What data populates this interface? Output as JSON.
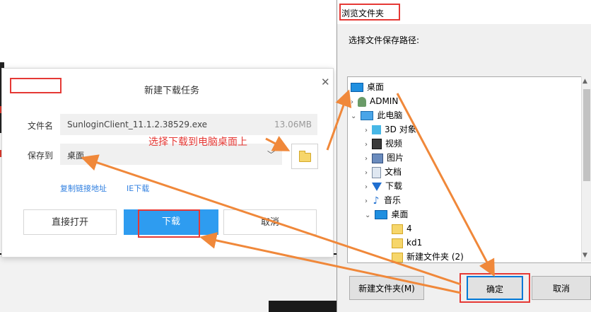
{
  "download_dialog": {
    "title": "新建下载任务",
    "close": "✕",
    "filename_label": "文件名",
    "filename": "SunloginClient_11.1.2.38529.exe",
    "filesize": "13.06MB",
    "saveto_label": "保存到",
    "saveto_value": "桌面",
    "copy_link": "复制链接地址",
    "ie_download": "IE下载",
    "btn_open": "直接打开",
    "btn_download": "下载",
    "btn_cancel": "取消"
  },
  "annotation": "选择下载到电脑桌面上",
  "browse_dialog": {
    "title": "浏览文件夹",
    "prompt": "选择文件保存路径:",
    "tree": [
      {
        "label": "桌面",
        "icon": "desktop-icon"
      },
      {
        "label": "ADMIN",
        "icon": "user-icon"
      },
      {
        "label": "此电脑",
        "icon": "computer-icon"
      },
      {
        "label": "3D 对象",
        "icon": "3d-objects-icon"
      },
      {
        "label": "视频",
        "icon": "video-icon"
      },
      {
        "label": "图片",
        "icon": "pictures-icon"
      },
      {
        "label": "文档",
        "icon": "documents-icon"
      },
      {
        "label": "下载",
        "icon": "download-icon"
      },
      {
        "label": "音乐",
        "icon": "music-icon"
      },
      {
        "label": "桌面",
        "icon": "desktop-icon"
      },
      {
        "label": "4",
        "icon": "folder-icon"
      },
      {
        "label": "kd1",
        "icon": "folder-icon"
      },
      {
        "label": "新建文件夹 (2)",
        "icon": "folder-icon"
      }
    ],
    "btn_new_folder": "新建文件夹(M)",
    "btn_ok": "确定",
    "btn_cancel": "取消"
  },
  "colors": {
    "accent": "#2e9cf0",
    "highlight": "#e53935",
    "arrow": "#f0883a"
  }
}
